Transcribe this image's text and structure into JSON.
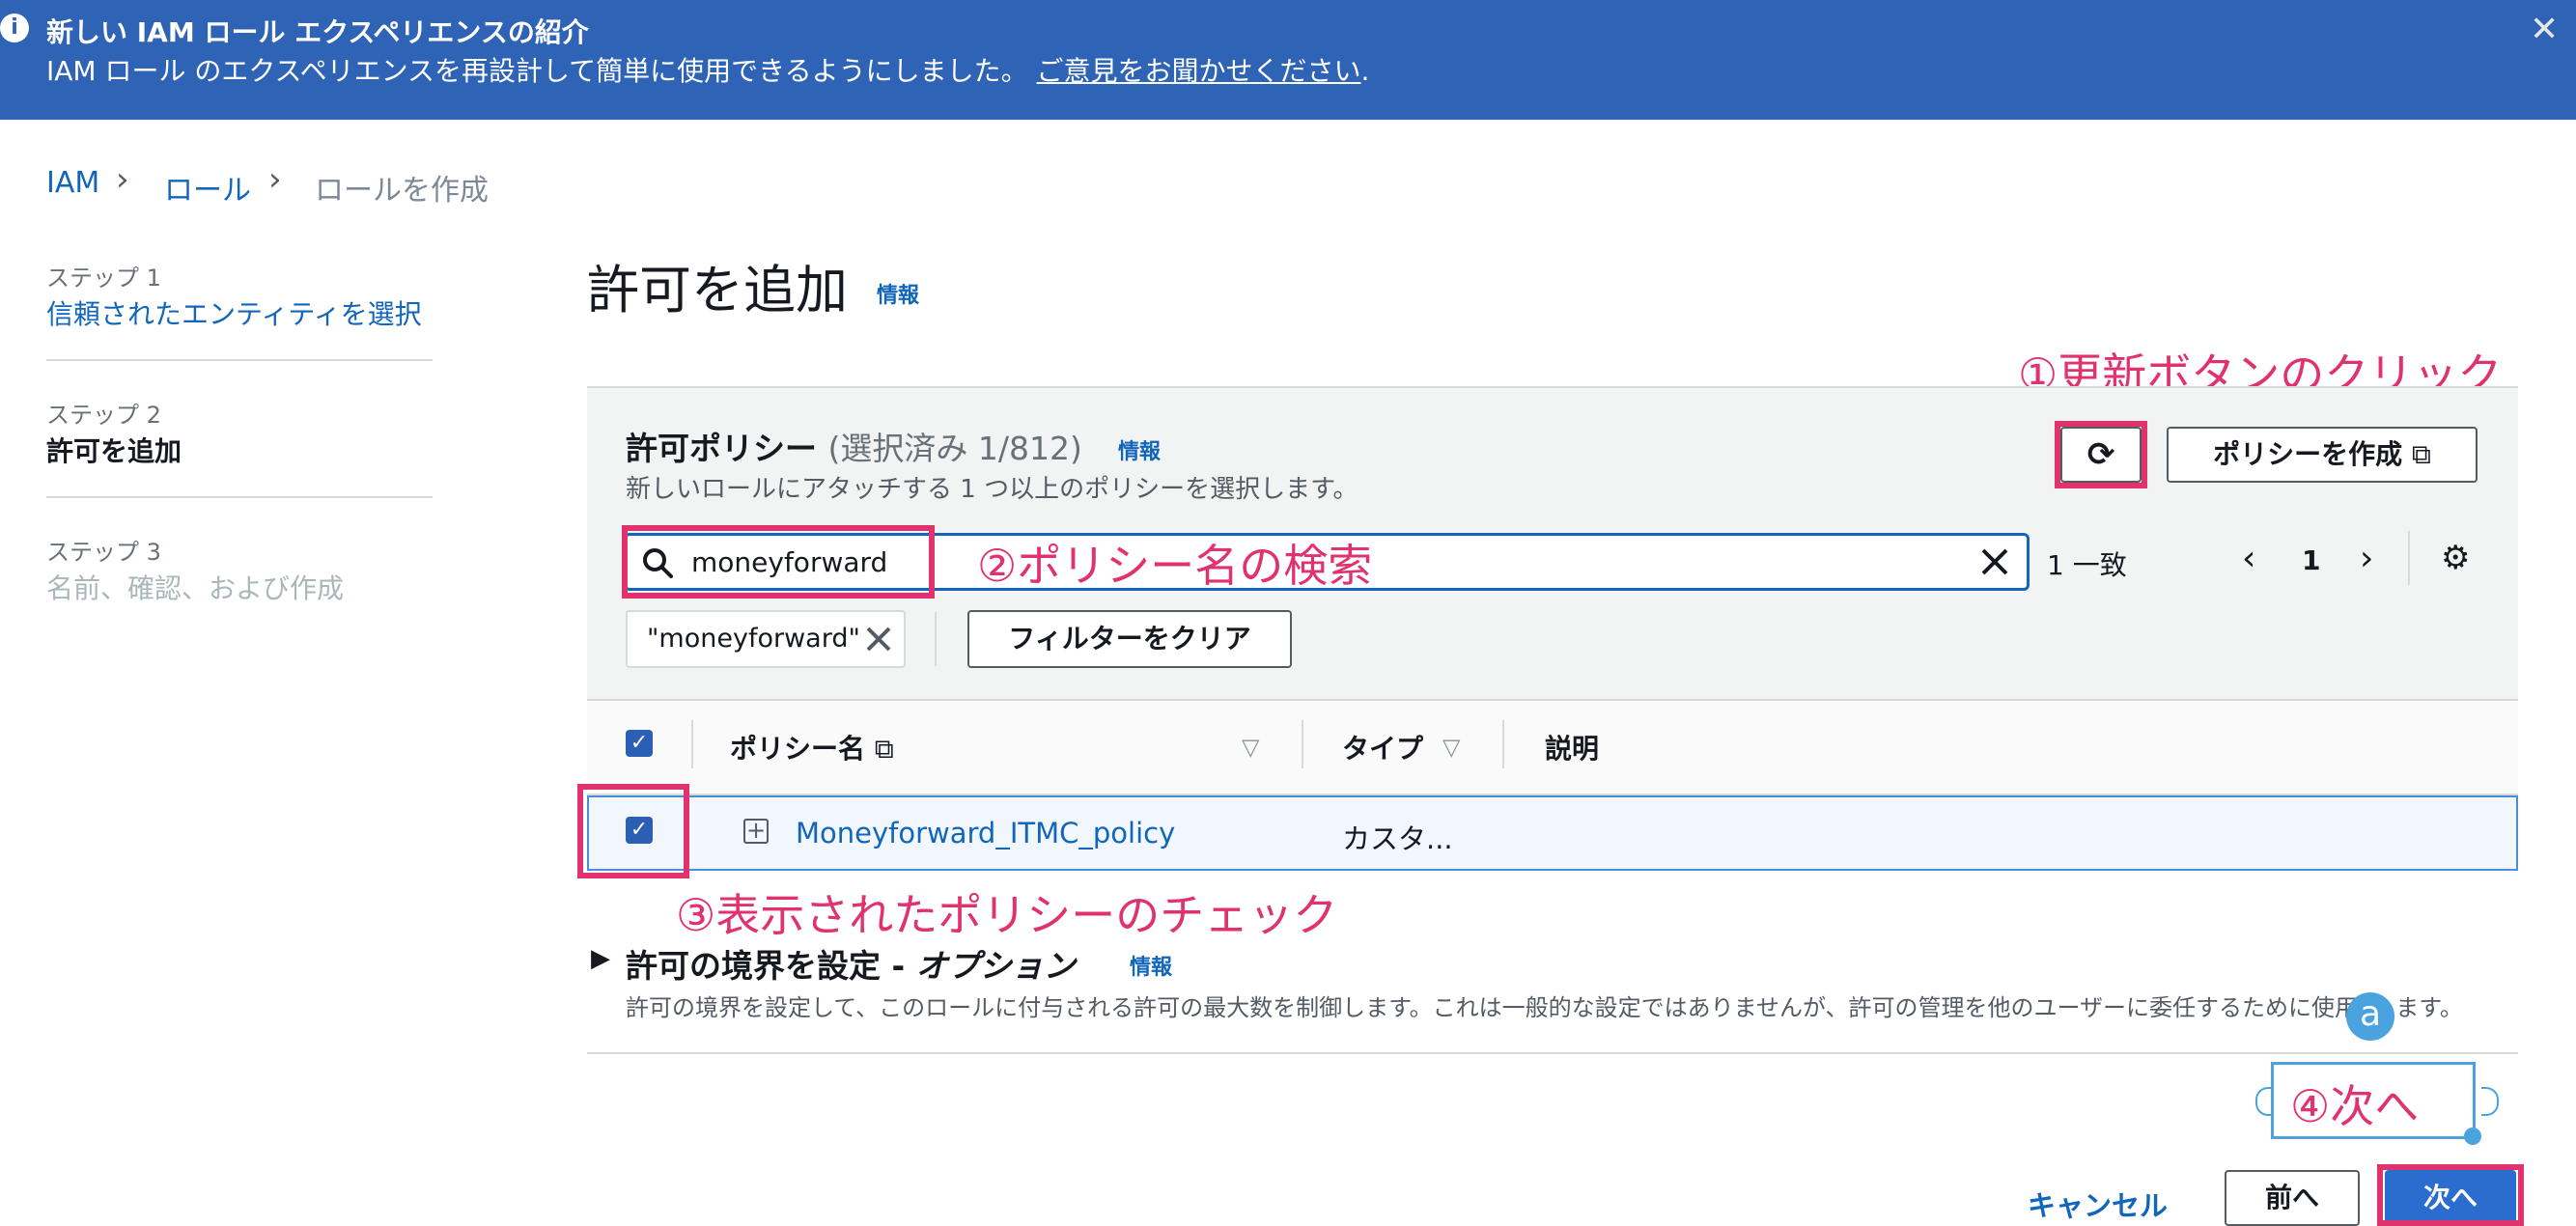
{
  "banner": {
    "title": "新しい IAM ロール エクスペリエンスの紹介",
    "text": "IAM ロール のエクスペリエンスを再設計して簡単に使用できるようにしました。",
    "link": "ご意見をお聞かせください",
    "period": ".",
    "info_icon": "i",
    "close_icon": "✕"
  },
  "breadcrumb": [
    "IAM",
    "ロール",
    "ロールを作成"
  ],
  "steps": [
    {
      "small": "ステップ 1",
      "label": "信頼されたエンティティを選択"
    },
    {
      "small": "ステップ 2",
      "label": "許可を追加"
    },
    {
      "small": "ステップ 3",
      "label": "名前、確認、および作成"
    }
  ],
  "page": {
    "title": "許可を追加",
    "info": "情報"
  },
  "policies": {
    "title": "許可ポリシー",
    "count": "(選択済み 1/812)",
    "info": "情報",
    "desc": "新しいロールにアタッチする 1 つ以上のポリシーを選択します。",
    "create_button": "ポリシーを作成",
    "search_value": "moneyforward",
    "match_text": "1 一致",
    "page_number": "1",
    "chip": "\"moneyforward\"",
    "clear_filter": "フィルターをクリア",
    "columns": [
      "ポリシー名",
      "タイプ",
      "説明"
    ],
    "rows": [
      {
        "name": "Moneyforward_ITMC_policy",
        "type": "カスタ..."
      }
    ]
  },
  "boundary": {
    "title_a": "許可の境界を設定 - ",
    "title_b": "オプション",
    "info": "情報",
    "desc": "許可の境界を設定して、このロールに付与される許可の最大数を制御します。これは一般的な設定ではありませんが、許可の管理を他のユーザーに委任するために使用 … ます。"
  },
  "footer": {
    "cancel": "キャンセル",
    "prev": "前へ",
    "next": "次へ"
  },
  "annotations": {
    "a1": "①更新ボタンのクリック",
    "a2": "②ポリシー名の検索",
    "a3": "③表示されたポリシーのチェック",
    "a4": "④次へ",
    "badge": "a"
  },
  "colors": {
    "accent": "#e0336e",
    "brand": "#2e63b5",
    "link": "#1166bb"
  }
}
